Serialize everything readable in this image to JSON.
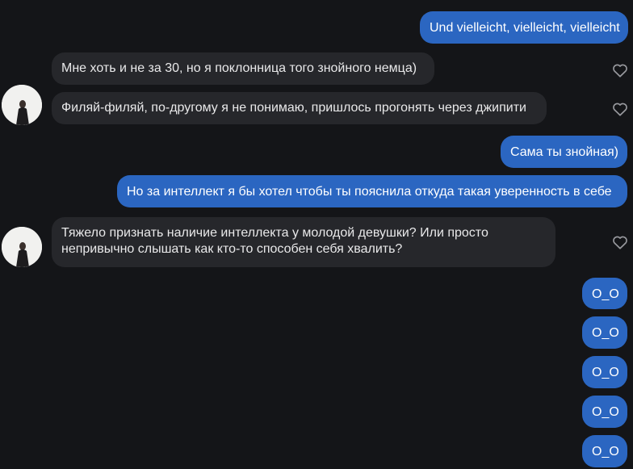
{
  "messages": {
    "m1": "Und vielleicht, vielleicht, vielleicht",
    "m2": "Мне хоть и не за 30, но я поклонница того знойного немца)",
    "m3": "Филяй-филяй, по-другому я не понимаю, пришлось прогонять через джипити",
    "m4": "Сама ты знойная)",
    "m5": "Но за интеллект я бы хотел чтобы ты пояснила откуда такая уверенность в себе",
    "m6_line1": "Тяжело признать наличие интеллекта у молодой девушки? Или просто",
    "m6_line2": "непривычно слышать как кто-то способен себя хвалить?",
    "m7": "O_O",
    "m8": "O_O",
    "m9": "O_O",
    "m10": "O_O",
    "m11": "O_O"
  },
  "colors": {
    "background": "#141518",
    "outgoing_bubble": "#2b66c1",
    "incoming_bubble": "#26272b",
    "text": "#e9e9ea"
  },
  "icons": {
    "reaction": "heart-outline-icon",
    "avatar": "avatar-photo"
  }
}
